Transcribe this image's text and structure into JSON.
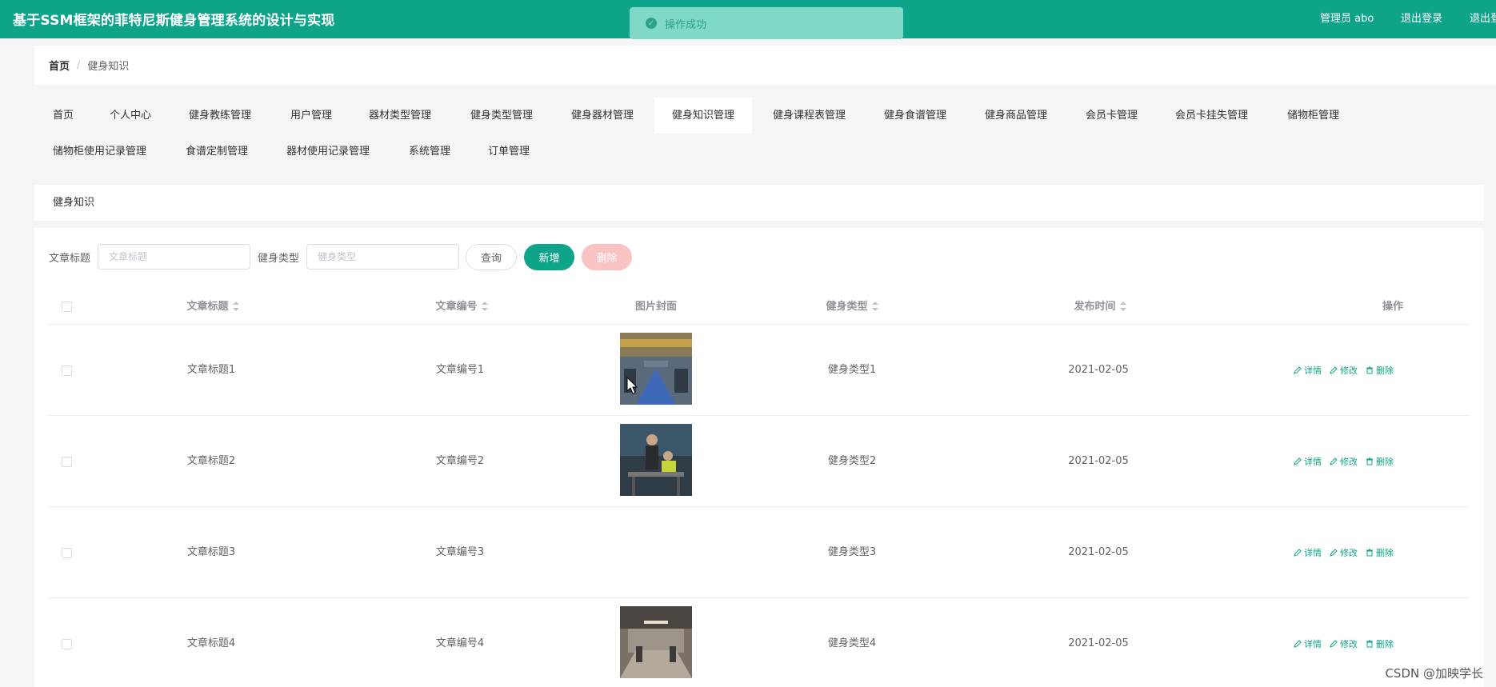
{
  "header": {
    "title": "基于SSM框架的菲特尼斯健身管理系统的设计与实现",
    "admin": "管理员 abo",
    "logout": "退出登录",
    "logout_clip": "退出登"
  },
  "toast": {
    "message": "操作成功"
  },
  "breadcrumb": {
    "home": "首页",
    "separator": "/",
    "current": "健身知识"
  },
  "menu": [
    "首页",
    "个人中心",
    "健身教练管理",
    "用户管理",
    "器材类型管理",
    "健身类型管理",
    "健身器材管理",
    "健身知识管理",
    "健身课程表管理",
    "健身食谱管理",
    "健身商品管理",
    "会员卡管理",
    "会员卡挂失管理",
    "储物柜管理",
    "储物柜使用记录管理",
    "食谱定制管理",
    "器材使用记录管理",
    "系统管理",
    "订单管理"
  ],
  "menu_active": "健身知识管理",
  "section_title": "健身知识",
  "search": {
    "title_label": "文章标题",
    "title_placeholder": "文章标题",
    "type_label": "健身类型",
    "type_placeholder": "健身类型",
    "query": "查询",
    "add": "新增",
    "delete": "删除"
  },
  "table": {
    "columns": [
      "文章标题",
      "文章编号",
      "图片封面",
      "健身类型",
      "发布时间",
      "操作"
    ],
    "rows": [
      {
        "title": "文章标题1",
        "number": "文章编号1",
        "type": "健身类型1",
        "date": "2021-02-05",
        "cover": "gym-hall-image"
      },
      {
        "title": "文章标题2",
        "number": "文章编号2",
        "type": "健身类型2",
        "date": "2021-02-05",
        "cover": "gym-training-image"
      },
      {
        "title": "文章标题3",
        "number": "文章编号3",
        "type": "健身类型3",
        "date": "2021-02-05",
        "cover": ""
      },
      {
        "title": "文章标题4",
        "number": "文章编号4",
        "type": "健身类型4",
        "date": "2021-02-05",
        "cover": "gym-room-image"
      }
    ],
    "actions": {
      "detail": "详情",
      "edit": "修改",
      "delete": "删除"
    }
  },
  "watermark": "CSDN @加映学长",
  "colors": {
    "primary": "#0ea48a",
    "danger_light": "#f9c3c3",
    "toast_bg": "#7fd9c6"
  }
}
